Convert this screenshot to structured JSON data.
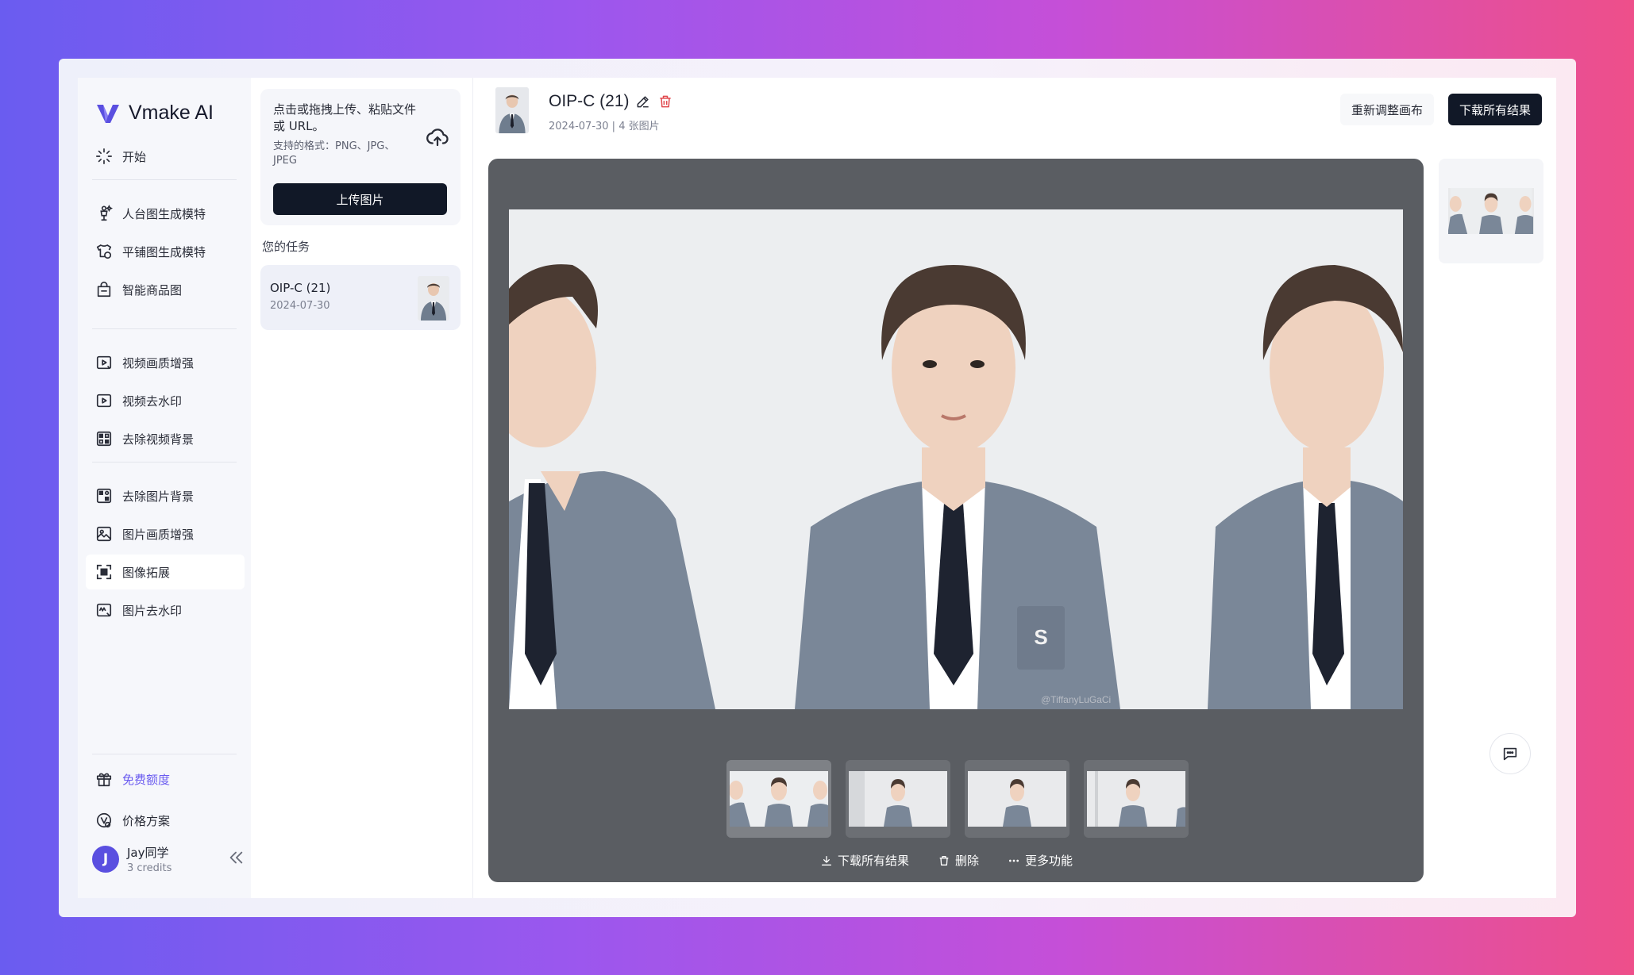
{
  "brand": {
    "name": "Vmake AI",
    "accent": "#5a4fe0"
  },
  "sidebar": {
    "start": "开始",
    "items": [
      {
        "label": "人台图生成模特",
        "icon": "mannequin-icon"
      },
      {
        "label": "平铺图生成模特",
        "icon": "flatlay-shirt-icon"
      },
      {
        "label": "智能商品图",
        "icon": "shopping-bag-icon"
      },
      {
        "label": "视频画质增强",
        "icon": "video-enhance-icon"
      },
      {
        "label": "视频去水印",
        "icon": "video-watermark-icon"
      },
      {
        "label": "去除视频背景",
        "icon": "video-background-icon"
      },
      {
        "label": "去除图片背景",
        "icon": "image-background-icon"
      },
      {
        "label": "图片画质增强",
        "icon": "image-enhance-icon"
      },
      {
        "label": "图像拓展",
        "icon": "image-expand-icon",
        "active": true
      },
      {
        "label": "图片去水印",
        "icon": "image-watermark-icon"
      }
    ],
    "free_quota": "免费额度",
    "pricing": "价格方案",
    "user": {
      "initial": "J",
      "name": "Jay同学",
      "credits": "3 credits"
    }
  },
  "upload": {
    "prompt": "点击或拖拽上传、粘贴文件或 URL。",
    "formats": "支持的格式：PNG、JPG、JPEG",
    "button": "上传图片"
  },
  "tasks": {
    "title": "您的任务",
    "items": [
      {
        "name": "OIP-C (21)",
        "date": "2024-07-30"
      }
    ]
  },
  "header": {
    "title": "OIP-C (21)",
    "meta": "2024-07-30 | 4 张图片",
    "rearrange": "重新调整画布",
    "download_all": "下载所有结果"
  },
  "viewer": {
    "thumbnails_count": 4,
    "selected_index": 0,
    "watermark": "@TiffanyLuGaCi",
    "actions": {
      "download": "下载所有结果",
      "delete": "删除",
      "more": "更多功能"
    }
  }
}
